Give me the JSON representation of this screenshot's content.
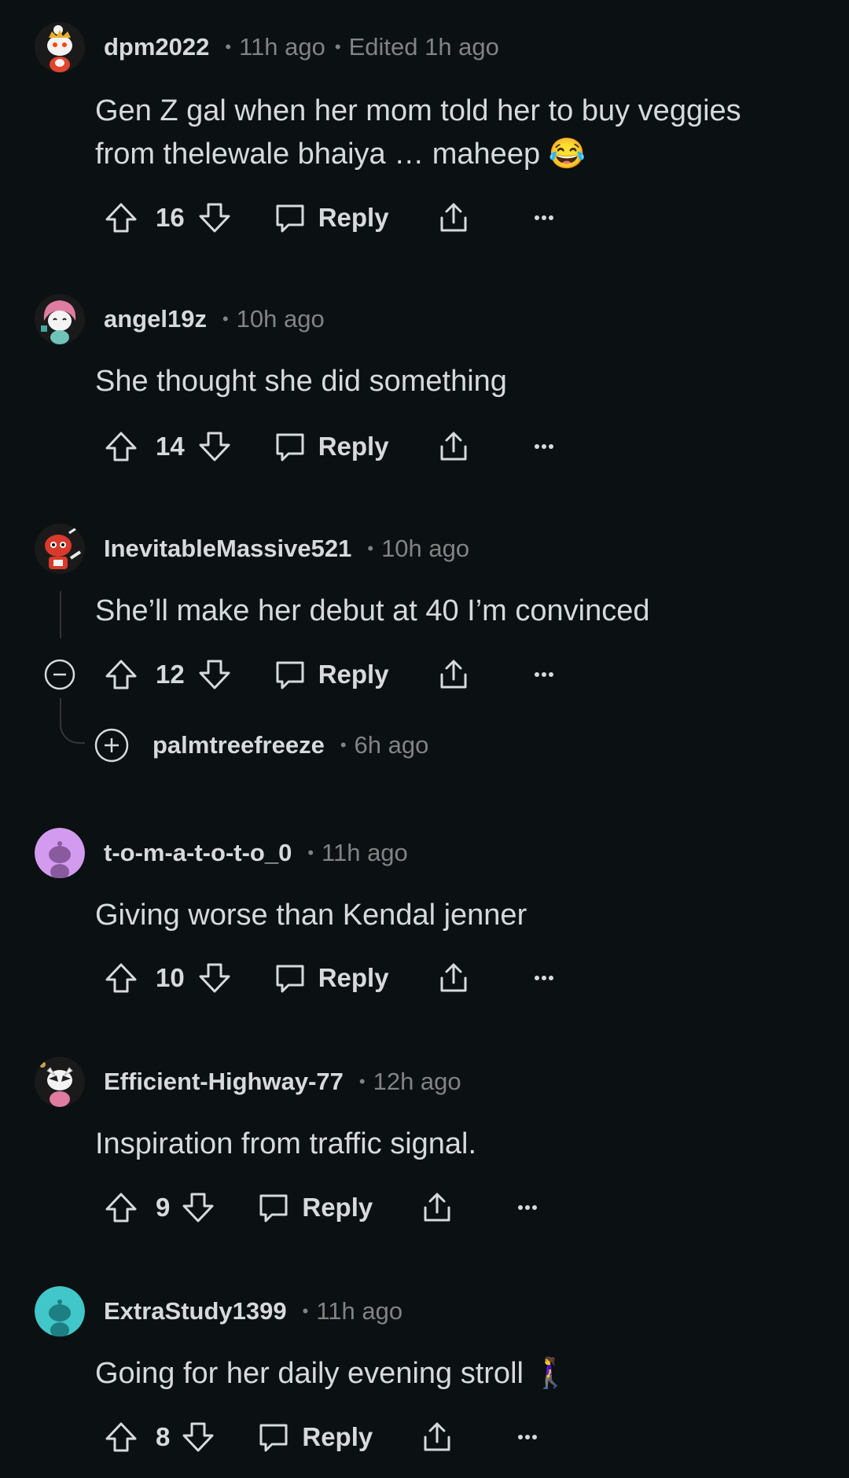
{
  "comments": [
    {
      "username": "dpm2022",
      "time": "11h ago",
      "edited": "Edited 1h ago",
      "body": "Gen Z gal when her mom told her to buy veggies from thelewale bhaiya … maheep 😂",
      "votes": "16",
      "reply_label": "Reply",
      "avatar": "snoo-crowned-avatar"
    },
    {
      "username": "angel19z",
      "time": "10h ago",
      "body": "She thought she did something",
      "votes": "14",
      "reply_label": "Reply",
      "avatar": "snoo-pink-hair-avatar"
    },
    {
      "username": "InevitableMassive521",
      "time": "10h ago",
      "body": "She’ll make her debut at 40 I’m convinced",
      "votes": "12",
      "reply_label": "Reply",
      "avatar": "snoo-red-avatar",
      "collapsed_reply": {
        "username": "palmtreefreeze",
        "time": "6h ago"
      }
    },
    {
      "username": "t-o-m-a-t-o-t-o_0",
      "time": "11h ago",
      "body": "Giving worse than Kendal jenner",
      "votes": "10",
      "reply_label": "Reply",
      "avatar": "default-snoo-purple-avatar"
    },
    {
      "username": "Efficient-Highway-77",
      "time": "12h ago",
      "body": "Inspiration from traffic signal.",
      "votes": "9",
      "reply_label": "Reply",
      "avatar": "snoo-masked-avatar"
    },
    {
      "username": "ExtraStudy1399",
      "time": "11h ago",
      "body": "Going for her daily evening stroll 🚶‍♀️",
      "votes": "8",
      "reply_label": "Reply",
      "avatar": "default-snoo-teal-avatar"
    }
  ],
  "colors": {
    "background": "#0b1012",
    "text": "#d7dadc",
    "muted": "#818384",
    "avatar_purple": "#d39bf0",
    "avatar_teal": "#41c6c9"
  }
}
